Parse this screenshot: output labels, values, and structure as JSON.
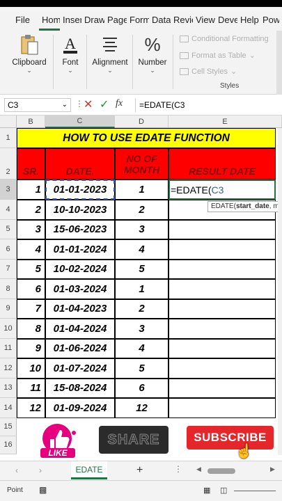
{
  "tabs": [
    "File",
    "Hom",
    "Inser",
    "Draw",
    "Page",
    "Form",
    "Data",
    "Revie",
    "View",
    "Deve",
    "Help",
    "Pow"
  ],
  "ribbon": {
    "clipboard": "Clipboard",
    "font": "Font",
    "alignment": "Alignment",
    "number": "Number",
    "cond_format": "Conditional Formatting",
    "format_table": "Format as Table",
    "cell_styles": "Cell Styles",
    "styles": "Styles"
  },
  "formula_bar": {
    "name_box": "C3",
    "fx": "fx",
    "formula": "=EDATE(C3"
  },
  "columns": [
    "B",
    "C",
    "D",
    "E"
  ],
  "rows": [
    "1",
    "2",
    "3",
    "4",
    "5",
    "6",
    "7",
    "8",
    "9",
    "10",
    "11",
    "12",
    "13",
    "14",
    "15",
    "16"
  ],
  "sheet": {
    "title": "HOW TO USE EDATE FUNCTION",
    "headers": {
      "sr": "SR.",
      "date": "DATE.",
      "no_of_month_1": "NO OF",
      "no_of_month_2": "MONTH",
      "result": "RESULT DATE"
    },
    "data": [
      {
        "sr": "1",
        "date": "01-01-2023",
        "months": "1"
      },
      {
        "sr": "2",
        "date": "10-10-2023",
        "months": "2"
      },
      {
        "sr": "3",
        "date": "15-06-2023",
        "months": "3"
      },
      {
        "sr": "4",
        "date": "01-01-2024",
        "months": "4"
      },
      {
        "sr": "5",
        "date": "10-02-2024",
        "months": "5"
      },
      {
        "sr": "6",
        "date": "01-03-2024",
        "months": "1"
      },
      {
        "sr": "7",
        "date": "01-04-2023",
        "months": "2"
      },
      {
        "sr": "8",
        "date": "01-04-2024",
        "months": "3"
      },
      {
        "sr": "9",
        "date": "01-06-2024",
        "months": "4"
      },
      {
        "sr": "10",
        "date": "01-07-2024",
        "months": "5"
      },
      {
        "sr": "11",
        "date": "15-08-2024",
        "months": "6"
      },
      {
        "sr": "12",
        "date": "01-09-2024",
        "months": "12"
      }
    ],
    "edit_prefix": "=EDATE(",
    "edit_ref": "C3",
    "tooltip_fn": "EDATE(",
    "tooltip_arg": "start_date",
    "tooltip_rest": ", m"
  },
  "overlay": {
    "like": "LIKE",
    "share": "SHARE",
    "subscribe": "SUBSCRIBE"
  },
  "sheet_tab": "EDATE",
  "add_sheet": "+",
  "status": "Point",
  "colors": {
    "title_bg": "#ffff00",
    "header_bg": "#ff0000",
    "excel_green": "#217346",
    "subscribe_red": "#e5262a"
  }
}
